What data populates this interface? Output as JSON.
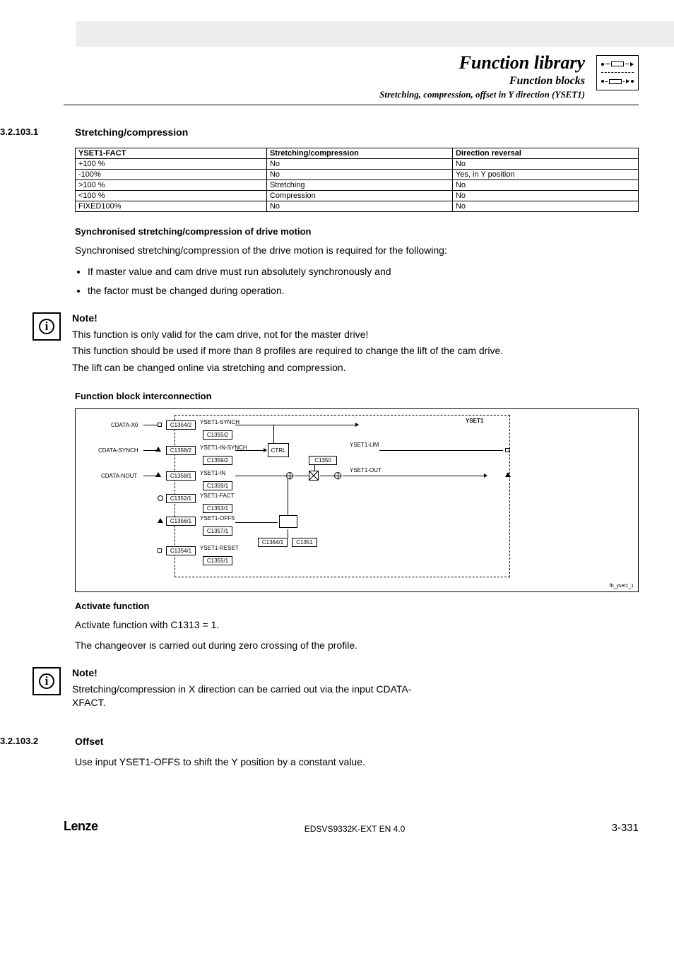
{
  "header": {
    "title": "Function library",
    "subtitle": "Function blocks",
    "subtitle2": "Stretching, compression, offset in Y direction (YSET1)"
  },
  "section1": {
    "num": "3.2.103.1",
    "title": "Stretching/compression",
    "table": {
      "h1": "YSET1-FACT",
      "h2": "Stretching/compression",
      "h3": "Direction reversal",
      "rows": [
        {
          "c1": "+100 %",
          "c2": "No",
          "c3": "No"
        },
        {
          "c1": "-100%",
          "c2": "No",
          "c3": "Yes, in Y position"
        },
        {
          "c1": ">100 %",
          "c2": "Stretching",
          "c3": "No"
        },
        {
          "c1": "<100 %",
          "c2": "Compression",
          "c3": "No"
        },
        {
          "c1": "FIXED100%",
          "c2": "No",
          "c3": "No"
        }
      ]
    },
    "sync_heading": "Synchronised stretching/compression of drive motion",
    "sync_text": "Synchronised stretching/compression of the drive motion is required for the following:",
    "bullet1": "If master value and cam drive must run absolutely synchronously and",
    "bullet2": "the factor must be changed during operation.",
    "note_title": "Note!",
    "note_p1": "This function is only valid for the cam drive, not for the master drive!",
    "note_p2": "This function should be used if more than 8 profiles are required to change the lift of the cam drive.",
    "note_p3": "The lift can be changed online via stretching and compression.",
    "interconn_title": "Function block interconnection",
    "diagram": {
      "block_title": "YSET1",
      "left": {
        "x0": "CDATA-X0",
        "synch": "CDATA-SYNCH",
        "nout": "CDATA-NOUT"
      },
      "rows": {
        "r1_sig": "YSET1-SYNCH",
        "r1_a": "C1354/2",
        "r1_b": "C1355/2",
        "r2_sig": "YSET1-IN-SYNCH",
        "r2_a": "C1358/2",
        "r2_b": "C1359/2",
        "r3_sig": "YSET1-IN",
        "r3_a": "C1358/1",
        "r3_b": "C1359/1",
        "r4_sig": "YSET1-FACT",
        "r4_a": "C1352/1",
        "r4_b": "C1353/1",
        "r5_sig": "YSET1-OFFS",
        "r5_a": "C1356/1",
        "r5_b": "C1357/1",
        "r6_sig": "YSET1-RESET",
        "r6_a": "C1354/1",
        "r6_b": "C1355/1"
      },
      "ctrl": "CTRL",
      "lim": "YSET1-LIM",
      "out": "YSET1-OUT",
      "c1350": "C1350",
      "c1364": "C1364/1",
      "c1351": "C1351",
      "caption": "fb_yset1_1"
    },
    "activate_title": "Activate function",
    "activate_p1": "Activate function with C1313 = 1.",
    "activate_p2": "The changeover is carried out during zero crossing of the profile.",
    "note2_title": "Note!",
    "note2_p1": "Stretching/compression in X direction can be carried out via the input CDATA-XFACT."
  },
  "section2": {
    "num": "3.2.103.2",
    "title": "Offset",
    "p1": "Use input YSET1-OFFS to shift the Y position by a constant value."
  },
  "footer": {
    "brand": "Lenze",
    "doc": "EDSVS9332K-EXT EN 4.0",
    "page": "3-331"
  }
}
